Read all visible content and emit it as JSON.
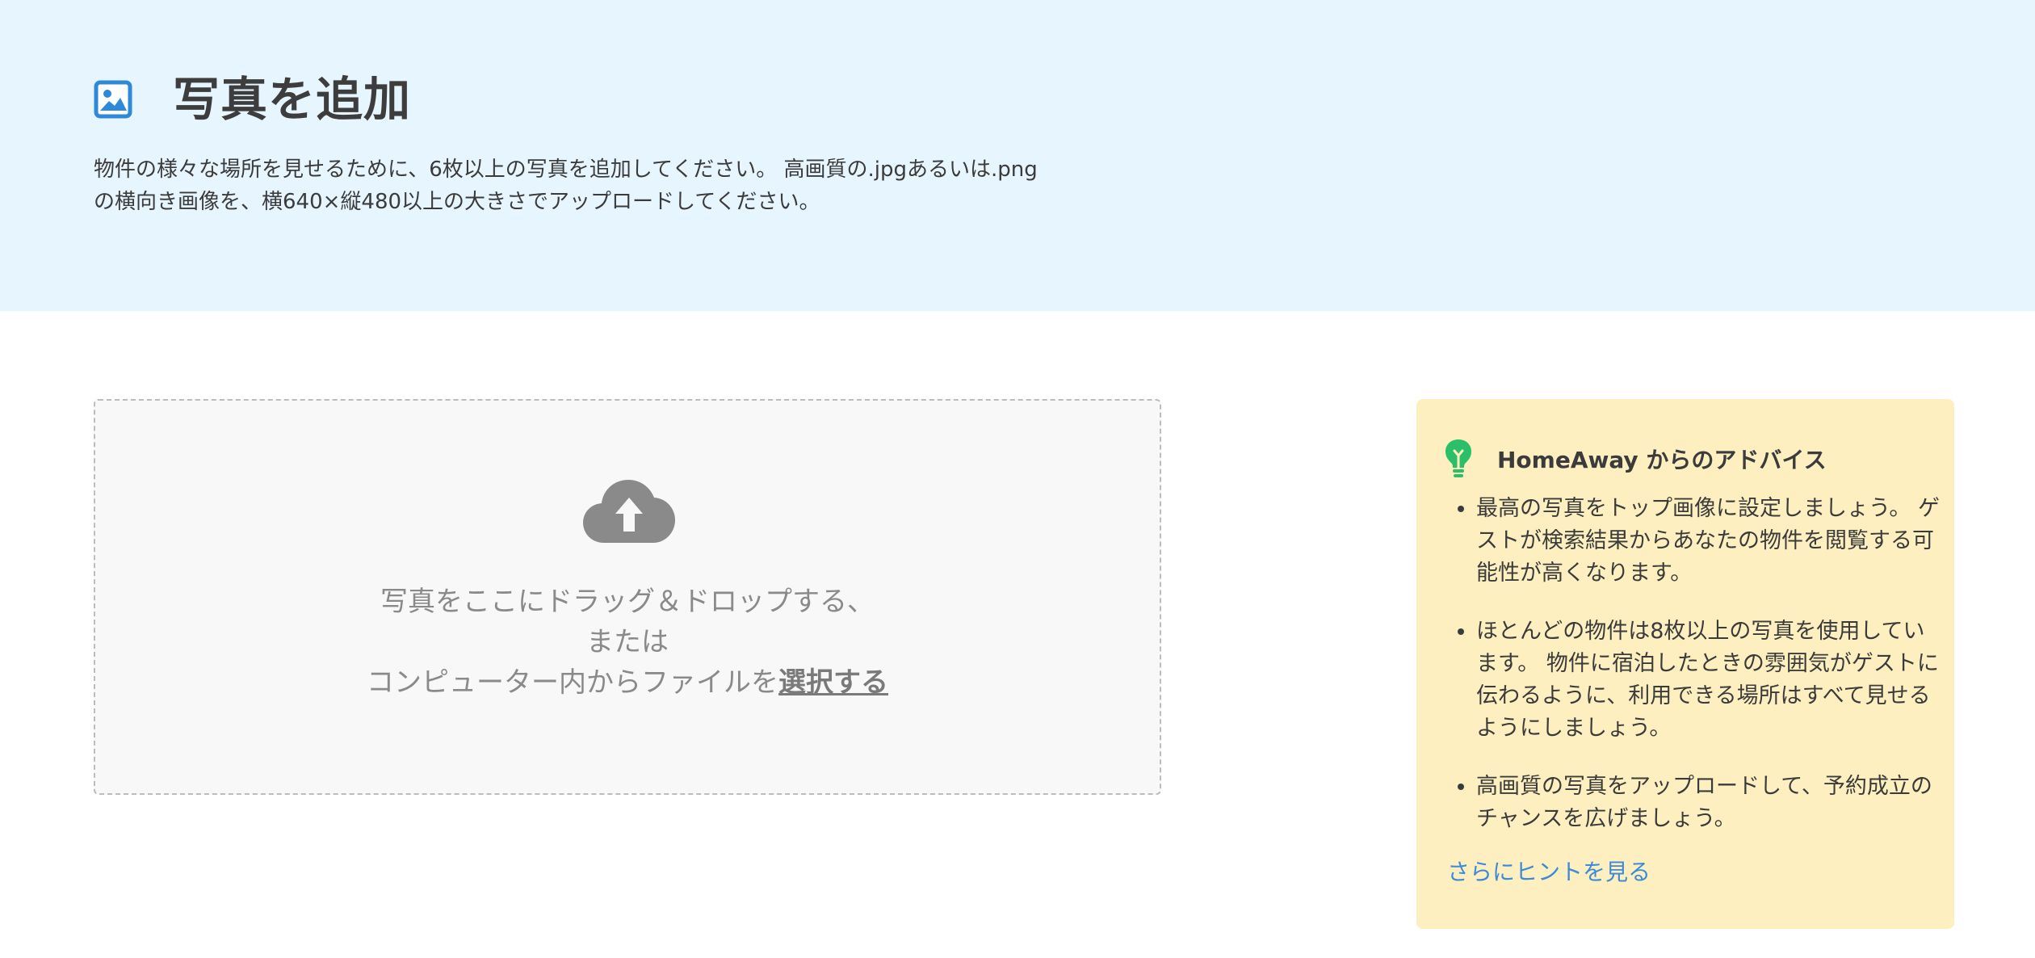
{
  "header": {
    "title": "写真を追加",
    "description": "物件の様々な場所を見せるために、6枚以上の写真を追加してください。 高画質の.jpgあるいは.pngの横向き画像を、横640×縦480以上の大きさでアップロードしてください。"
  },
  "dropzone": {
    "line1": "写真をここにドラッグ＆ドロップする、",
    "line2": "または",
    "line3_prefix": "コンピューター内からファイルを",
    "select_link": "選択する"
  },
  "advice": {
    "title": "HomeAway からのアドバイス",
    "items": [
      "最高の写真をトップ画像に設定しましょう。 ゲストが検索結果からあなたの物件を閲覧する可能性が高くなります。",
      "ほとんどの物件は8枚以上の写真を使用しています。 物件に宿泊したときの雰囲気がゲストに伝わるように、利用できる場所はすべて見せるようにしましょう。",
      "高画質の写真をアップロードして、予約成立のチャンスを広げましょう。"
    ],
    "more_link": "さらにヒントを見る"
  },
  "colors": {
    "header_bg": "#e6f5fe",
    "accent_blue": "#3d8ad8",
    "advice_bg": "#fdefbf",
    "bulb_green": "#2bbf6a",
    "icon_gray": "#8a8a8a"
  },
  "icons": {
    "title_icon": "image-icon",
    "upload_icon": "cloud-upload-icon",
    "advice_icon": "lightbulb-icon"
  }
}
